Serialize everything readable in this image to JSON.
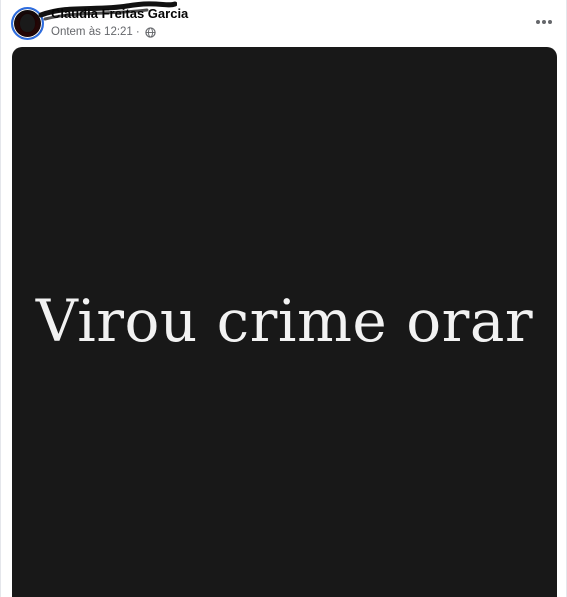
{
  "post": {
    "author": "Claudia Freitas Garcia",
    "timestamp": "Ontem às 12:21",
    "separator": "·",
    "privacy_icon": "globe-icon",
    "more_icon": "more-options-icon",
    "image_text": "Virou crime orar"
  },
  "colors": {
    "image_background": "#181818",
    "image_text": "#f2f2f2",
    "meta_text": "#65676b",
    "avatar_ring": "#2d6cdf"
  }
}
